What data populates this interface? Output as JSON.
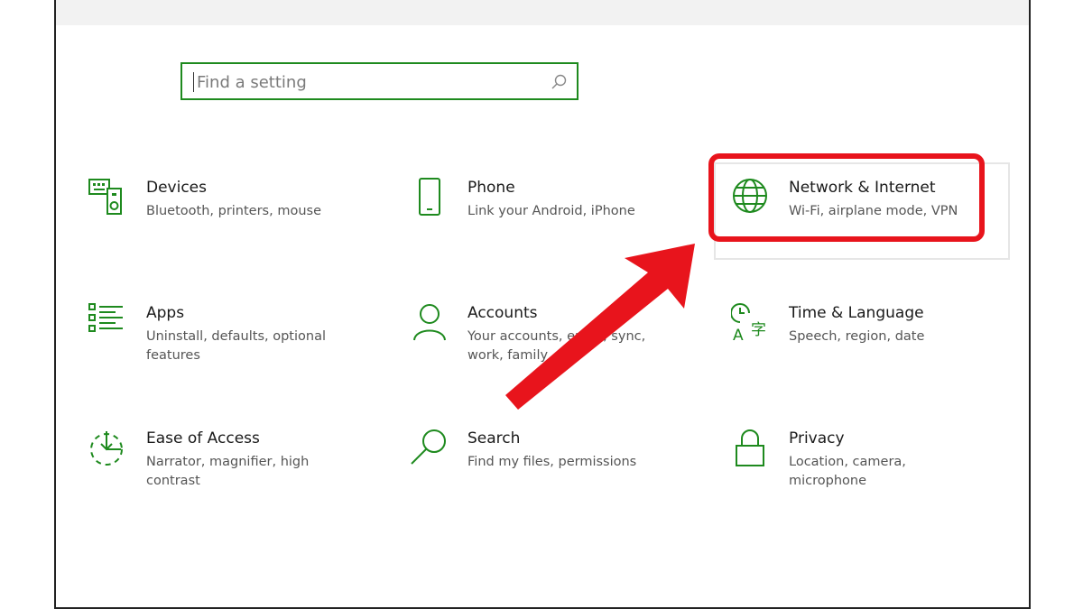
{
  "search": {
    "placeholder": "Find a setting"
  },
  "tiles": [
    {
      "title": "Devices",
      "desc": "Bluetooth, printers, mouse"
    },
    {
      "title": "Phone",
      "desc": "Link your Android, iPhone"
    },
    {
      "title": "Network & Internet",
      "desc": "Wi-Fi, airplane mode, VPN"
    },
    {
      "title": "Apps",
      "desc": "Uninstall, defaults, optional features"
    },
    {
      "title": "Accounts",
      "desc": "Your accounts, email, sync, work, family"
    },
    {
      "title": "Time & Language",
      "desc": "Speech, region, date"
    },
    {
      "title": "Ease of Access",
      "desc": "Narrator, magnifier, high contrast"
    },
    {
      "title": "Search",
      "desc": "Find my files, permissions"
    },
    {
      "title": "Privacy",
      "desc": "Location, camera, microphone"
    }
  ],
  "colors": {
    "accent": "#1e8a1e",
    "highlight": "#e8141c"
  }
}
